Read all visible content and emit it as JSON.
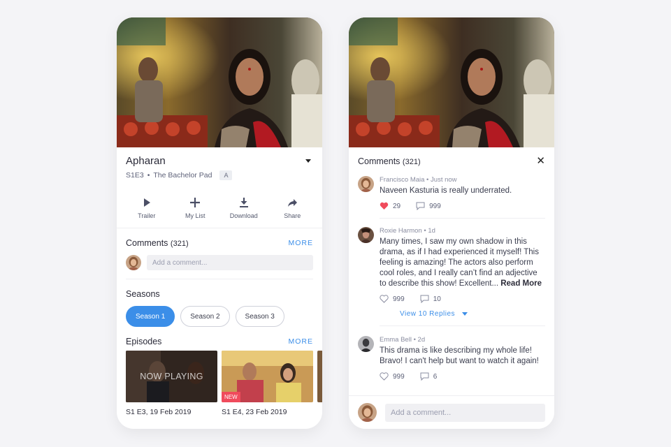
{
  "left": {
    "show_title": "Apharan",
    "episode_code": "S1E3",
    "episode_name": "The Bachelor Pad",
    "rating": "A",
    "actions": [
      {
        "label": "Trailer",
        "icon": "play-icon"
      },
      {
        "label": "My List",
        "icon": "plus-icon"
      },
      {
        "label": "Download",
        "icon": "download-icon"
      },
      {
        "label": "Share",
        "icon": "share-icon"
      }
    ],
    "comments_title": "Comments",
    "comments_count": "(321)",
    "more_label": "MORE",
    "comment_placeholder": "Add a comment...",
    "seasons_title": "Seasons",
    "seasons": [
      "Season 1",
      "Season 2",
      "Season 3"
    ],
    "active_season": "Season 1",
    "episodes_title": "Episodes",
    "episodes": [
      {
        "label": "S1 E3, 19 Feb 2019",
        "overlay": "NOW PLAYING"
      },
      {
        "label": "S1 E4, 23 Feb 2019",
        "badge": "NEW"
      }
    ]
  },
  "right": {
    "title": "Comments",
    "count": "(321)",
    "close_icon": "close-icon",
    "comments": [
      {
        "author": "Francisco Maia",
        "time": "Just now",
        "text": "Naveen Kasturia is really underrated.",
        "likes": "29",
        "liked": true,
        "replies": "999"
      },
      {
        "author": "Roxie Harmon",
        "time": "1d",
        "text": "Many times, I saw my own shadow in this drama, as if I had experienced it myself! This feeling is amazing! The actors also perform cool roles, and I really can’t find an adjective to describe this show! Excellent...",
        "read_more": "Read More",
        "likes": "999",
        "liked": false,
        "replies": "10",
        "view_replies": "View 10 Replies"
      },
      {
        "author": "Emma Bell",
        "time": "2d",
        "text": "This drama is like describing my whole life! Bravo! I can't help but want to watch it again!",
        "likes": "999",
        "liked": false,
        "replies": "6"
      }
    ],
    "comment_placeholder": "Add a comment..."
  },
  "colors": {
    "accent": "#3b8ee8",
    "heart": "#f04b5c",
    "new_badge": "#f04b5c",
    "background": "#f4f4f7"
  }
}
